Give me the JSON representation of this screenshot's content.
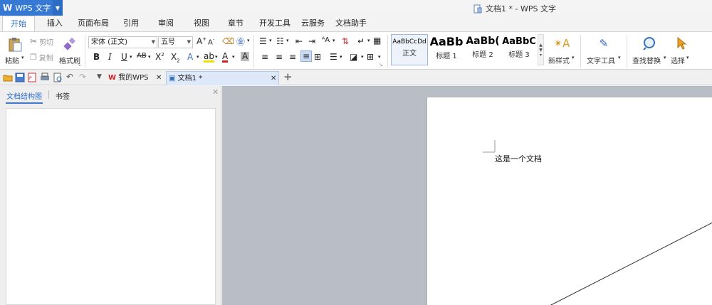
{
  "app": {
    "logo": "W",
    "name": "WPS 文字"
  },
  "window_title": "文档1 * - WPS 文字",
  "menu_tabs": [
    "开始",
    "插入",
    "页面布局",
    "引用",
    "审阅",
    "视图",
    "章节",
    "开发工具",
    "云服务",
    "文档助手"
  ],
  "ribbon": {
    "paste": "粘贴",
    "cut": "剪切",
    "copy": "复制",
    "format_painter": "格式刷",
    "font_name": "宋体 (正文)",
    "font_size": "五号",
    "styles": [
      {
        "sample": "AaBbCcDd",
        "label": "正文"
      },
      {
        "sample": "AaBb",
        "label": "标题 1"
      },
      {
        "sample": "AaBb(",
        "label": "标题 2"
      },
      {
        "sample": "AaBbC",
        "label": "标题 3"
      }
    ],
    "new_style": "新样式",
    "text_tools": "文字工具",
    "find_replace": "查找替换",
    "select": "选择"
  },
  "doc_tabs": {
    "wps": "我的WPS",
    "doc": "文档1 *"
  },
  "nav_tabs": {
    "outline": "文档结构图",
    "bookmark": "书签"
  },
  "doc_text": "这是一个文档"
}
